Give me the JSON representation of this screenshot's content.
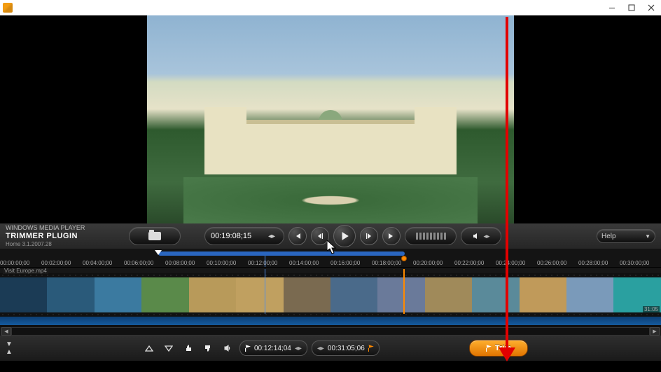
{
  "window": {
    "title": ""
  },
  "plugin": {
    "host": "WINDOWS MEDIA PLAYER",
    "name": "TRIMMER PLUGIN",
    "version": "Home 3.1.2007.28",
    "help_label": "Help"
  },
  "playback": {
    "current_time": "00:19:08;15"
  },
  "timeline": {
    "ticks": [
      "00:00:00;00",
      "00:02:00;00",
      "00:04:00;00",
      "00:06:00;00",
      "00:08:00;00",
      "00:10:00;00",
      "00:12:00;00",
      "00:14:00;00",
      "00:16:00;00",
      "00:18:00;00",
      "00:20:00;00",
      "00:22:00;00",
      "00:24:00;00",
      "00:26:00;00",
      "00:28:00;00",
      "00:30:00;00"
    ],
    "clip_name": "Visit Europe.mp4",
    "clip_duration": "31:05"
  },
  "markers": {
    "in_time": "00:12:14;04",
    "out_time": "00:31:05;06"
  },
  "actions": {
    "trim_label": "Trim"
  },
  "annotation_color": "#e20000"
}
